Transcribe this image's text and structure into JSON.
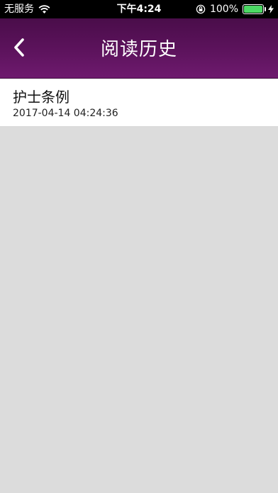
{
  "status_bar": {
    "carrier": "无服务",
    "time": "下午4:24",
    "battery_percent": "100%",
    "battery_level": 1.0,
    "battery_color": "#4cd964"
  },
  "nav": {
    "title": "阅读历史",
    "back_icon": "chevron-left-icon",
    "gradient_colors": [
      "#4a0d4a",
      "#6e1a6e"
    ]
  },
  "history": [
    {
      "title": "护士条例",
      "timestamp": "2017-04-14 04:24:36"
    }
  ]
}
